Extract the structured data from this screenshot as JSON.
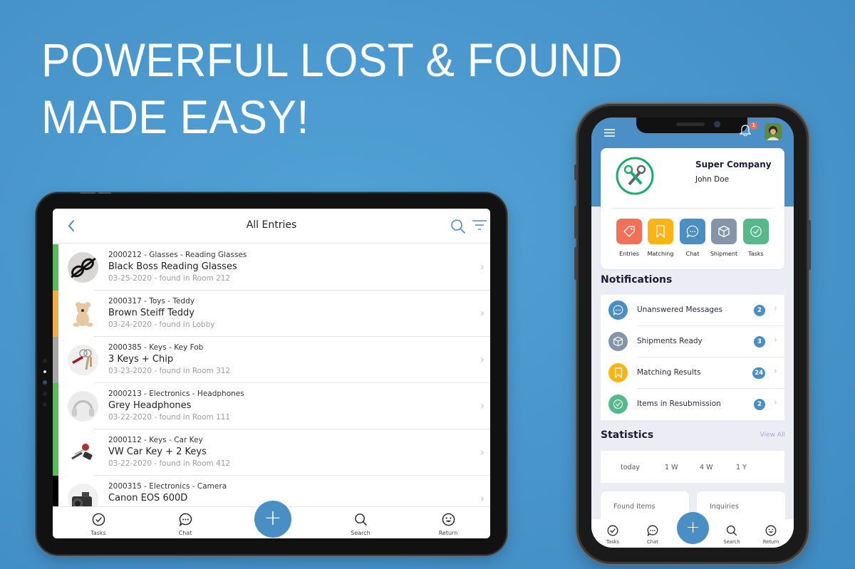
{
  "headline": {
    "line1": "POWERFUL LOST & FOUND",
    "line2": "MADE EASY!"
  },
  "colors": {
    "background": "#4a97cd",
    "accent": "#4a8fc4",
    "entries": "#f07158",
    "matching": "#fbb415",
    "chat": "#4a8fc4",
    "shipment": "#8594a8",
    "tasks": "#55b98b",
    "badge_red": "#ee6a55",
    "view_all": "#a9a3e6"
  },
  "tablet": {
    "header": {
      "back_icon": "chevron-left-icon",
      "title": "All Entries",
      "search_icon": "search-icon",
      "filter_icon": "filter-icon"
    },
    "entries": [
      {
        "meta": "2000212 - Glasses - Reading Glasses",
        "title": "Black Boss Reading Glasses",
        "detail": "03-25-2020 - found in Room 212",
        "status_color": "#5cb85c",
        "thumb": "glasses"
      },
      {
        "meta": "2000317 - Toys - Teddy",
        "title": "Brown Steiff Teddy",
        "detail": "03-24-2020 - found in Lobby",
        "status_color": "#f0ad4e",
        "thumb": "teddy"
      },
      {
        "meta": "2000385 - Keys - Key Fob",
        "title": "3 Keys + Chip",
        "detail": "03-23-2020 - found in Room 312",
        "status_color": "#a6a6a6",
        "thumb": "keys"
      },
      {
        "meta": "2000213 - Electronics - Headphones",
        "title": "Grey Headphones",
        "detail": "03-22-2020 - found in Room 111",
        "status_color": "#5cb85c",
        "thumb": "headphones"
      },
      {
        "meta": "2000112 - Keys - Car Key",
        "title": "VW Car Key + 2 Keys",
        "detail": "03-22-2020 - found in Room 412",
        "status_color": "#5cb85c",
        "thumb": "carkey"
      },
      {
        "meta": "2000315 - Electronics - Camera",
        "title": "Canon EOS 600D",
        "detail": "",
        "status_color": "#000000",
        "thumb": "camera"
      }
    ],
    "tabbar": {
      "tasks": "Tasks",
      "chat": "Chat",
      "add": "+",
      "search": "Search",
      "return": "Return"
    }
  },
  "phone": {
    "notification_count": "1",
    "company": "Super Company",
    "user": "John Doe",
    "quick_actions": [
      {
        "label": "Entries",
        "icon": "tag-icon",
        "color": "#f07158"
      },
      {
        "label": "Matching",
        "icon": "bookmark-icon",
        "color": "#fbb415"
      },
      {
        "label": "Chat",
        "icon": "chat-icon",
        "color": "#4a8fc4"
      },
      {
        "label": "Shipment",
        "icon": "box-icon",
        "color": "#8594a8"
      },
      {
        "label": "Tasks",
        "icon": "check-circle-icon",
        "color": "#55b98b"
      }
    ],
    "notifications_title": "Notifications",
    "notifications": [
      {
        "label": "Unanswered Messages",
        "count": "2",
        "icon": "chat-icon",
        "color": "#4a8fc4"
      },
      {
        "label": "Shipments Ready",
        "count": "3",
        "icon": "box-icon",
        "color": "#8594a8"
      },
      {
        "label": "Matching Results",
        "count": "24",
        "icon": "bookmark-icon",
        "color": "#fbb415"
      },
      {
        "label": "Items in Resubmission",
        "count": "2",
        "icon": "check-circle-icon",
        "color": "#55b98b"
      }
    ],
    "statistics_title": "Statistics",
    "view_all": "View All",
    "periods": [
      "today",
      "1 W",
      "4 W",
      "1 Y"
    ],
    "stats": [
      {
        "label": "Found Items"
      },
      {
        "label": "Inquiries"
      }
    ],
    "tabbar": {
      "tasks": "Tasks",
      "chat": "Chat",
      "add": "+",
      "search": "Search",
      "return": "Return"
    }
  }
}
